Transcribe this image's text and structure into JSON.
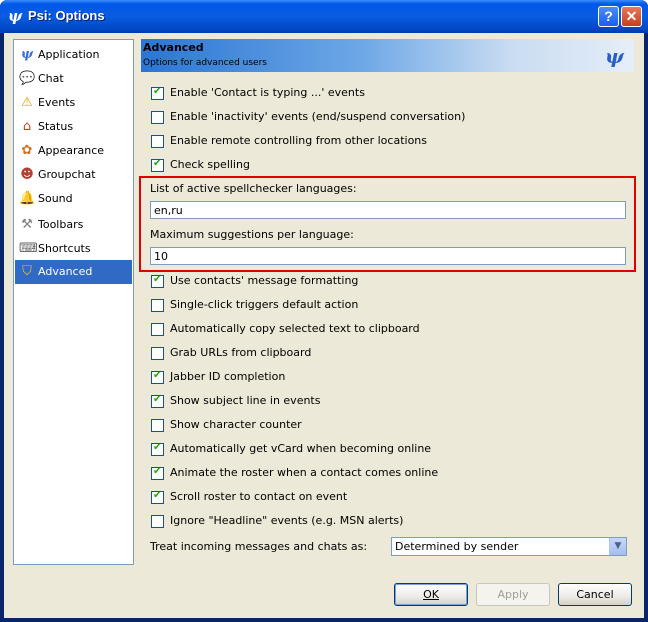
{
  "window": {
    "title": "Psi: Options"
  },
  "sidebar": {
    "items": [
      {
        "label": "Application",
        "icon": "psi-icon"
      },
      {
        "label": "Chat",
        "icon": "chat-icon"
      },
      {
        "label": "Events",
        "icon": "warning-icon"
      },
      {
        "label": "Status",
        "icon": "house-icon"
      },
      {
        "label": "Appearance",
        "icon": "palette-icon"
      },
      {
        "label": "Groupchat",
        "icon": "group-icon"
      },
      {
        "label": "Sound",
        "icon": "bell-icon"
      },
      {
        "label": "Toolbars",
        "icon": "tools-icon"
      },
      {
        "label": "Shortcuts",
        "icon": "keyboard-icon"
      },
      {
        "label": "Advanced",
        "icon": "shield-icon",
        "selected": true
      }
    ]
  },
  "banner": {
    "title": "Advanced",
    "subtitle": "Options for advanced users"
  },
  "options": {
    "typing": {
      "label": "Enable 'Contact is typing ...' events",
      "checked": true
    },
    "inactivity": {
      "label": "Enable 'inactivity' events (end/suspend conversation)",
      "checked": false
    },
    "remote": {
      "label": "Enable remote controlling from other locations",
      "checked": false
    },
    "spelling": {
      "label": "Check spelling",
      "checked": true
    },
    "spell_languages_label": "List of active spellchecker languages:",
    "spell_languages_value": "en,ru",
    "max_suggestions_label": "Maximum suggestions per language:",
    "max_suggestions_value": "10",
    "contacts_formatting": {
      "label": "Use contacts' message formatting",
      "checked": true
    },
    "single_click": {
      "label": "Single-click triggers default action",
      "checked": false
    },
    "auto_copy": {
      "label": "Automatically copy selected text to clipboard",
      "checked": false
    },
    "grab_urls": {
      "label": "Grab URLs from clipboard",
      "checked": false
    },
    "jid_completion": {
      "label": "Jabber ID completion",
      "checked": true
    },
    "subject_line": {
      "label": "Show subject line in events",
      "checked": true
    },
    "char_counter": {
      "label": "Show character counter",
      "checked": false
    },
    "vcard": {
      "label": "Automatically get vCard when becoming online",
      "checked": true
    },
    "animate_roster": {
      "label": "Animate the roster when a contact comes online",
      "checked": true
    },
    "scroll_roster": {
      "label": "Scroll roster to contact on event",
      "checked": true
    },
    "ignore_headline": {
      "label": "Ignore \"Headline\" events (e.g. MSN alerts)",
      "checked": false
    },
    "treat_incoming_label": "Treat incoming messages and chats as:",
    "treat_incoming_value": "Determined by sender"
  },
  "buttons": {
    "ok": "OK",
    "apply": "Apply",
    "cancel": "Cancel"
  },
  "colors": {
    "selection": "#316ac5",
    "highlight_border": "#e00000",
    "dialog_bg": "#ece9d8"
  }
}
